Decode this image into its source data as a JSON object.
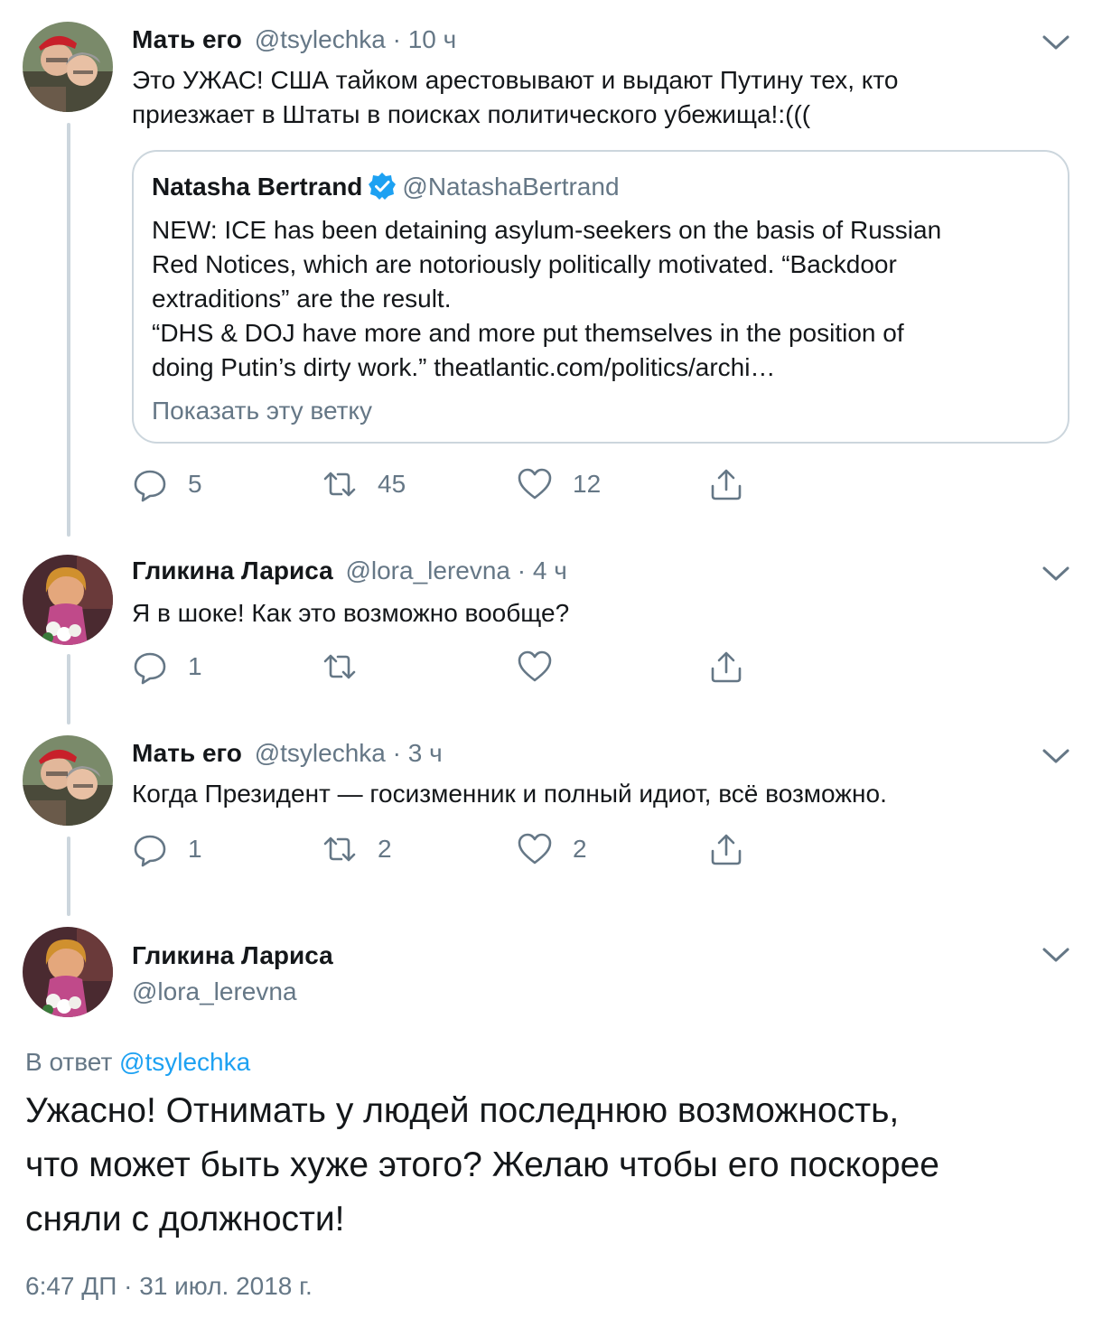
{
  "colors": {
    "text": "#14171a",
    "muted": "#657786",
    "link": "#1da1f2",
    "border": "#ccd6dd",
    "verified": "#1da1f2"
  },
  "tweets": [
    {
      "name": "Мать его",
      "handle": "@tsylechka",
      "time": "10 ч",
      "text_lines": [
        "Это УЖАС! США тайком арестовывают и выдают Путину тех, кто",
        "приезжает в Штаты в поисках политического убежища!:((("
      ],
      "quote": {
        "name": "Natasha Bertrand",
        "handle": "@NatashaBertrand",
        "verified_icon": "verified-badge-icon",
        "text_lines": [
          "NEW: ICE has been detaining asylum-seekers on the basis of Russian",
          "Red Notices, which are notoriously politically motivated. “Backdoor",
          "extraditions” are the result.",
          "“DHS & DOJ have more and more put themselves in the position of",
          "doing Putin’s dirty work.” theatlantic.com/politics/archi…"
        ],
        "show_thread": "Показать эту ветку"
      },
      "actions": {
        "reply": "5",
        "retweet": "45",
        "like": "12"
      }
    },
    {
      "name": "Гликина Лариса",
      "handle": "@lora_lerevna",
      "time": "4 ч",
      "text_lines": [
        "Я в шоке! Как это возможно вообще?"
      ],
      "actions": {
        "reply": "1",
        "retweet": "",
        "like": ""
      }
    },
    {
      "name": "Мать его",
      "handle": "@tsylechka",
      "time": "3 ч",
      "text_lines": [
        "Когда Президент — госизменник и полный идиот, всё возможно."
      ],
      "actions": {
        "reply": "1",
        "retweet": "2",
        "like": "2"
      }
    }
  ],
  "main_tweet": {
    "name": "Гликина Лариса",
    "handle": "@lora_lerevna",
    "reply_prefix": "В ответ",
    "reply_handle": "@tsylechka",
    "text_lines": [
      "Ужасно! Отнимать у людей последнюю возможность,",
      "что может быть хуже этого? Желаю чтобы его поскорее",
      "сняли с должности!"
    ],
    "timestamp": "6:47 ДП · 31 июл. 2018 г."
  },
  "icons": {
    "reply": "reply-icon",
    "retweet": "retweet-icon",
    "like": "heart-icon",
    "share": "share-icon",
    "menu": "chevron-down-icon"
  }
}
